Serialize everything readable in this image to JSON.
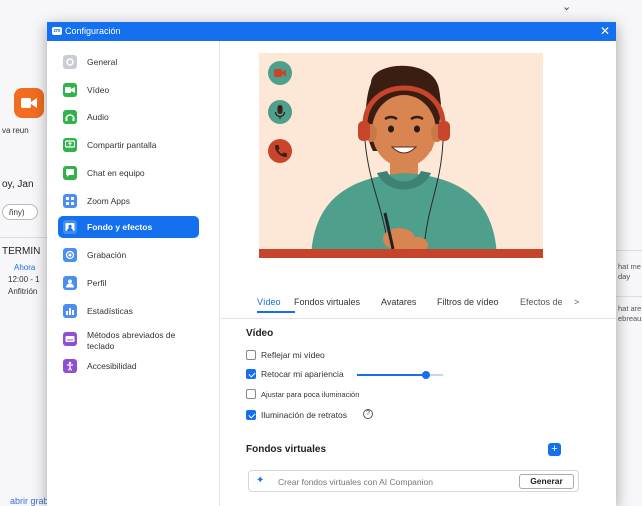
{
  "background_app": {
    "left_snippet_meeting": "va reun",
    "date_fragment": "oy, Jan",
    "pill_text": "ñny)",
    "item_title": "TERMIN",
    "item_line1": "Ahora",
    "item_line2": "12:00 - 1",
    "item_line3": "Anfitrión",
    "right_snippet_1": "hat me",
    "right_snippet_2": "day",
    "right_snippet_3": "hat are",
    "right_snippet_4": "ebreaux",
    "bottom_link": "abrir grabaciones  >"
  },
  "dialog": {
    "title": "Configuración",
    "close_glyph": "✕",
    "logo_text": "zm"
  },
  "sidebar": {
    "items": [
      {
        "label": "General",
        "icon": "gear-icon",
        "color": "#8b8f99"
      },
      {
        "label": "Vídeo",
        "icon": "video-icon",
        "color": "#2fb34a"
      },
      {
        "label": "Audio",
        "icon": "headphones-icon",
        "color": "#2fb34a"
      },
      {
        "label": "Compartir pantalla",
        "icon": "share-screen-icon",
        "color": "#2fb34a"
      },
      {
        "label": "Chat en equipo",
        "icon": "chat-icon",
        "color": "#2fb34a"
      },
      {
        "label": "Zoom Apps",
        "icon": "apps-icon",
        "color": "#4a8ff0"
      },
      {
        "label": "Fondo y efectos",
        "icon": "background-icon",
        "color": "#1570ef"
      },
      {
        "label": "Grabación",
        "icon": "record-icon",
        "color": "#4a8ff0"
      },
      {
        "label": "Perfil",
        "icon": "profile-icon",
        "color": "#4a8ff0"
      },
      {
        "label": "Estadísticas",
        "icon": "stats-icon",
        "color": "#4a8ff0"
      },
      {
        "label": "Métodos abreviados de teclado",
        "icon": "keyboard-icon",
        "color": "#8e4fd6"
      },
      {
        "label": "Accesibilidad",
        "icon": "accessibility-icon",
        "color": "#8e4fd6"
      }
    ],
    "active_index": 6
  },
  "tabs": {
    "items": [
      "Vídeo",
      "Fondos virtuales",
      "Avatares",
      "Filtros de vídeo",
      "Efectos de"
    ],
    "active_index": 0,
    "scroll_arrow": ">"
  },
  "video_section": {
    "title": "Vídeo",
    "options": [
      {
        "label": "Reflejar mi vídeo",
        "checked": false
      },
      {
        "label": "Retocar mi apariencia",
        "checked": true
      },
      {
        "label": "Ajustar para poca iluminación",
        "checked": false
      },
      {
        "label": "Iluminación de retratos",
        "checked": true
      }
    ],
    "touchup_level": 0.8,
    "help_glyph": "?"
  },
  "virtual_bg": {
    "title": "Fondos virtuales",
    "add_glyph": "+",
    "ai_placeholder": "Crear fondos virtuales con AI Companion",
    "generate_label": "Generar"
  },
  "colors": {
    "accent": "#1570ef",
    "illustration_bg": "#fde8d7",
    "hoodie": "#4e9f8c",
    "skin": "#d98552",
    "hair": "#3b1e12",
    "headphones": "#c8452b"
  }
}
